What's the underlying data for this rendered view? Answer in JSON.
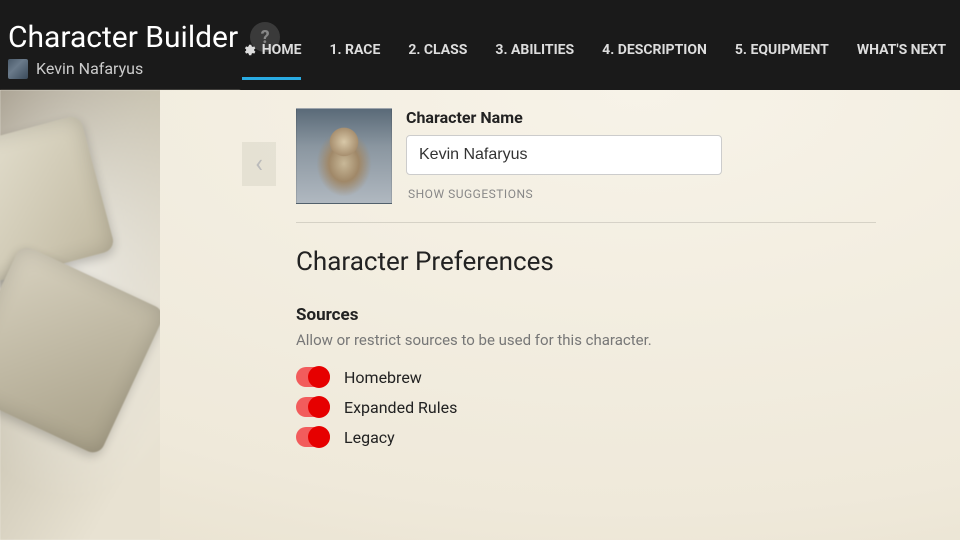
{
  "header": {
    "app_title": "Character Builder",
    "character_name": "Kevin Nafaryus",
    "help_label": "?"
  },
  "nav": {
    "items": [
      {
        "label": "HOME",
        "icon": "gear-icon",
        "active": true
      },
      {
        "label": "1. RACE"
      },
      {
        "label": "2. CLASS"
      },
      {
        "label": "3. ABILITIES"
      },
      {
        "label": "4. DESCRIPTION"
      },
      {
        "label": "5. EQUIPMENT"
      },
      {
        "label": "WHAT'S NEXT"
      }
    ]
  },
  "main": {
    "prev_symbol": "‹",
    "name_field": {
      "label": "Character Name",
      "value": "Kevin Nafaryus"
    },
    "show_suggestions": "SHOW SUGGESTIONS",
    "preferences_title": "Character Preferences",
    "sources": {
      "title": "Sources",
      "description": "Allow or restrict sources to be used for this character.",
      "items": [
        {
          "label": "Homebrew",
          "on": true
        },
        {
          "label": "Expanded Rules",
          "on": true
        },
        {
          "label": "Legacy",
          "on": true
        }
      ]
    }
  }
}
